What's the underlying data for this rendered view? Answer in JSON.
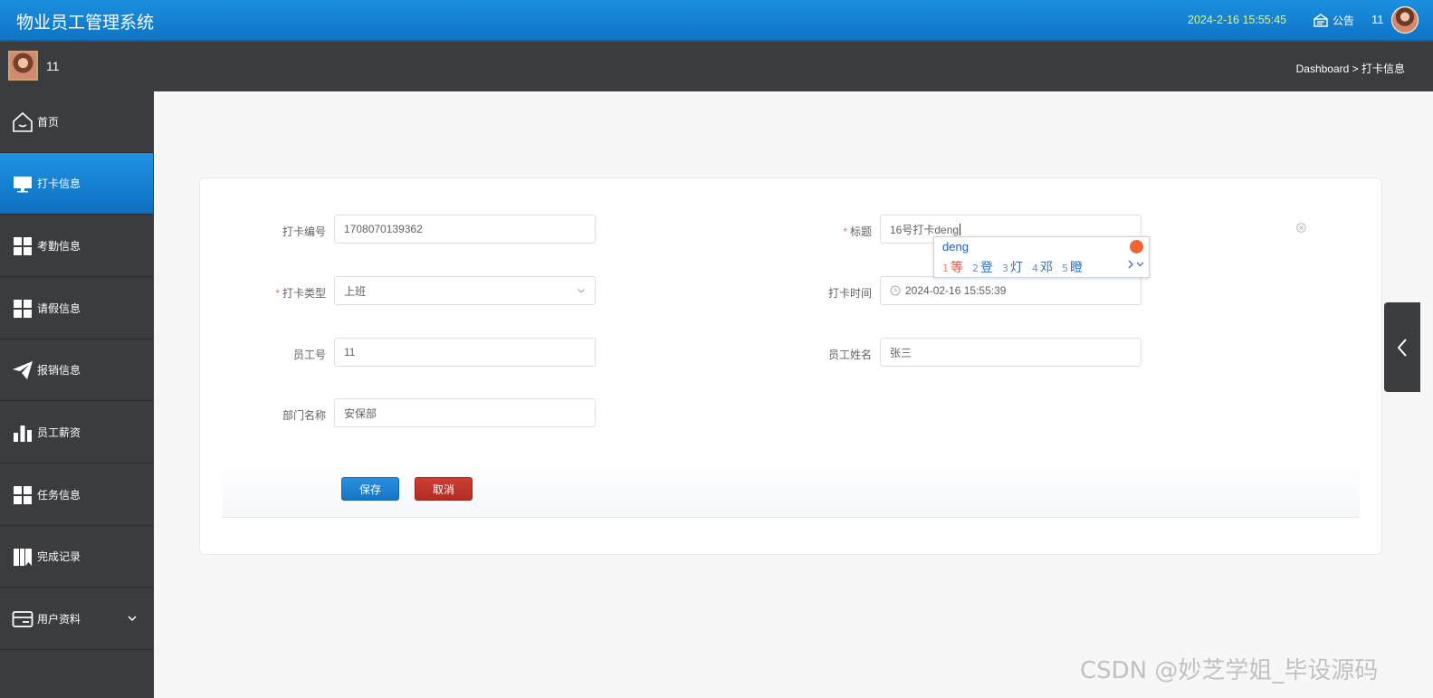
{
  "header": {
    "title": "物业员工管理系统",
    "datetime": "2024-2-16 15:55:45",
    "notice_label": "公告",
    "username": "11"
  },
  "subheader": {
    "username": "11",
    "breadcrumb": "Dashboard > 打卡信息"
  },
  "sidebar": {
    "items": [
      {
        "label": "首页",
        "icon": "home-icon"
      },
      {
        "label": "打卡信息",
        "icon": "monitor-icon"
      },
      {
        "label": "考勤信息",
        "icon": "grid-icon"
      },
      {
        "label": "请假信息",
        "icon": "grid-icon"
      },
      {
        "label": "报销信息",
        "icon": "paper-plane-icon"
      },
      {
        "label": "员工薪资",
        "icon": "bar-chart-icon"
      },
      {
        "label": "任务信息",
        "icon": "grid-icon"
      },
      {
        "label": "完成记录",
        "icon": "book-icon"
      },
      {
        "label": "用户资料",
        "icon": "card-icon"
      }
    ]
  },
  "form": {
    "punch_no": {
      "label": "打卡编号",
      "value": "1708070139362"
    },
    "title": {
      "label": "标题",
      "value": "16号打卡deng"
    },
    "punch_type": {
      "label": "打卡类型",
      "value": "上班"
    },
    "punch_time": {
      "label": "打卡时间",
      "value": "2024-02-16 15:55:39"
    },
    "employee_no": {
      "label": "员工号",
      "value": "11"
    },
    "employee_name": {
      "label": "员工姓名",
      "value": "张三"
    },
    "department": {
      "label": "部门名称",
      "value": "安保部"
    },
    "save_label": "保存",
    "cancel_label": "取消"
  },
  "ime": {
    "composition": "deng",
    "candidates": [
      {
        "n": "1",
        "text": "等"
      },
      {
        "n": "2",
        "text": "登"
      },
      {
        "n": "3",
        "text": "灯"
      },
      {
        "n": "4",
        "text": "邓"
      },
      {
        "n": "5",
        "text": "瞪"
      }
    ]
  },
  "watermark": "CSDN @妙芝学姐_毕设源码",
  "colors": {
    "header_blue": "#1c8fe0",
    "sidebar_dark": "#3b3c40",
    "save_blue": "#1675c5",
    "cancel_red": "#b32c24",
    "required_red": "#f56c6c"
  }
}
